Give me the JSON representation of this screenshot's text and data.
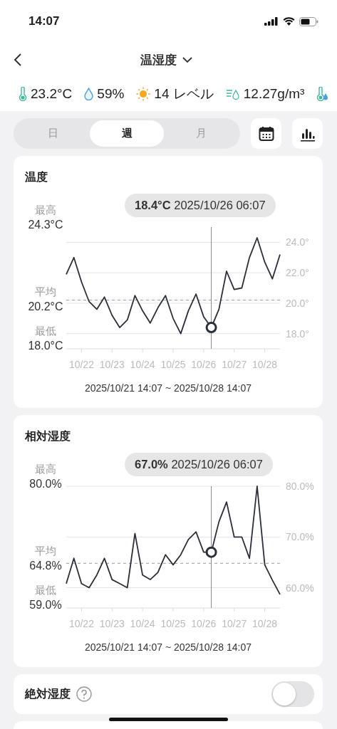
{
  "status_bar": {
    "time": "14:07"
  },
  "nav": {
    "title": "温湿度"
  },
  "readings": [
    {
      "kind": "temperature",
      "value": "23.2°C"
    },
    {
      "kind": "humidity",
      "value": "59%"
    },
    {
      "kind": "light",
      "value": "14 レベル"
    },
    {
      "kind": "absolute_humidity",
      "value": "12.27g/m³"
    },
    {
      "kind": "dew_point"
    }
  ],
  "period_tabs": [
    {
      "label": "日",
      "selected": false
    },
    {
      "label": "週",
      "selected": true
    },
    {
      "label": "月",
      "selected": false
    }
  ],
  "cards": [
    {
      "title": "温度",
      "stats": [
        {
          "label": "最高",
          "value": "24.3°C"
        },
        {
          "label": "平均",
          "value": "20.2°C"
        },
        {
          "label": "最低",
          "value": "18.0°C"
        }
      ],
      "tooltip": "**18.4°C** 2025/10/26 06:07",
      "range": "2025/10/21 14:07 ~ 2025/10/28 14:07",
      "chart_data": {
        "type": "line",
        "categories": [
          null,
          null,
          "10/22",
          null,
          null,
          null,
          "10/23",
          null,
          null,
          null,
          "10/24",
          null,
          null,
          null,
          "10/25",
          null,
          null,
          null,
          "10/26",
          null,
          null,
          null,
          "10/27",
          null,
          null,
          null,
          "10/28",
          null,
          null
        ],
        "series": [
          {
            "color": "#2b2f3a",
            "values": [
              21.9,
              23.0,
              21.4,
              20.1,
              19.6,
              20.4,
              19.2,
              18.4,
              18.9,
              20.5,
              19.5,
              18.7,
              19.7,
              20.5,
              19.0,
              18.0,
              19.5,
              20.6,
              19.1,
              18.4,
              19.6,
              22.1,
              20.9,
              21.0,
              23.0,
              24.3,
              22.7,
              21.6,
              23.2
            ]
          }
        ],
        "grid": true,
        "ylim": [
          17,
          25
        ],
        "yticks": [
          {
            "value": 18,
            "label": "18.0°"
          },
          {
            "value": 20,
            "label": "20.0°"
          },
          {
            "value": 22,
            "label": "22.0°"
          },
          {
            "value": 24,
            "label": "24.0°"
          }
        ],
        "ref_lines": [
          {
            "axis": "y",
            "value": 20.2
          }
        ]
      }
    },
    {
      "title": "相対湿度",
      "stats": [
        {
          "label": "最高",
          "value": "80.0%"
        },
        {
          "label": "平均",
          "value": "64.8%"
        },
        {
          "label": "最低",
          "value": "59.0%"
        }
      ],
      "tooltip": "**67.0%** 2025/10/26 06:07",
      "range": "2025/10/21 14:07 ~ 2025/10/28 14:07",
      "chart_data": {
        "type": "line",
        "categories": [
          null,
          null,
          "10/22",
          null,
          null,
          null,
          "10/23",
          null,
          null,
          null,
          "10/24",
          null,
          null,
          null,
          "10/25",
          null,
          null,
          null,
          "10/26",
          null,
          null,
          null,
          "10/27",
          null,
          null,
          null,
          "10/28",
          null,
          null
        ],
        "series": [
          {
            "color": "#2b2f3a",
            "values": [
              60.8,
              65.8,
              60.8,
              60.0,
              62.5,
              65.8,
              61.6,
              60.8,
              60.0,
              70.7,
              62.5,
              61.6,
              63.0,
              66.5,
              64.5,
              66.5,
              69.5,
              71.0,
              67.0,
              67.0,
              73.0,
              76.9,
              70.0,
              70.0,
              65.8,
              80.0,
              64.5,
              61.5,
              58.7
            ]
          }
        ],
        "grid": true,
        "ylim": [
          56,
          80
        ],
        "yticks": [
          {
            "value": 60,
            "label": "60.0%"
          },
          {
            "value": 70,
            "label": "70.0%"
          },
          {
            "value": 80,
            "label": "80.0%"
          }
        ],
        "ref_lines": [
          {
            "axis": "y",
            "value": 64.8
          }
        ]
      }
    }
  ],
  "absolute_humidity": {
    "label": "絶対湿度",
    "on": false
  }
}
